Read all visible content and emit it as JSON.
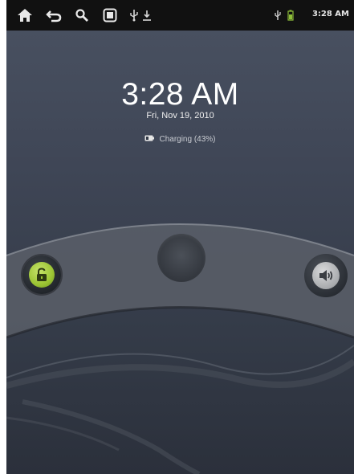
{
  "status_bar": {
    "icons": [
      "home-icon",
      "back-icon",
      "search-icon",
      "app-icon",
      "usb-icon",
      "download-icon",
      "usb-small-icon",
      "battery-icon"
    ],
    "time": "3:28 AM"
  },
  "lock_screen": {
    "time": "3:28 AM",
    "date": "Fri, Nov 19, 2010",
    "charging_text": "Charging (43%)",
    "unlock_icon": "unlock-padlock-icon",
    "sound_icon": "sound-volume-icon",
    "accent_color": "#9bc433"
  }
}
